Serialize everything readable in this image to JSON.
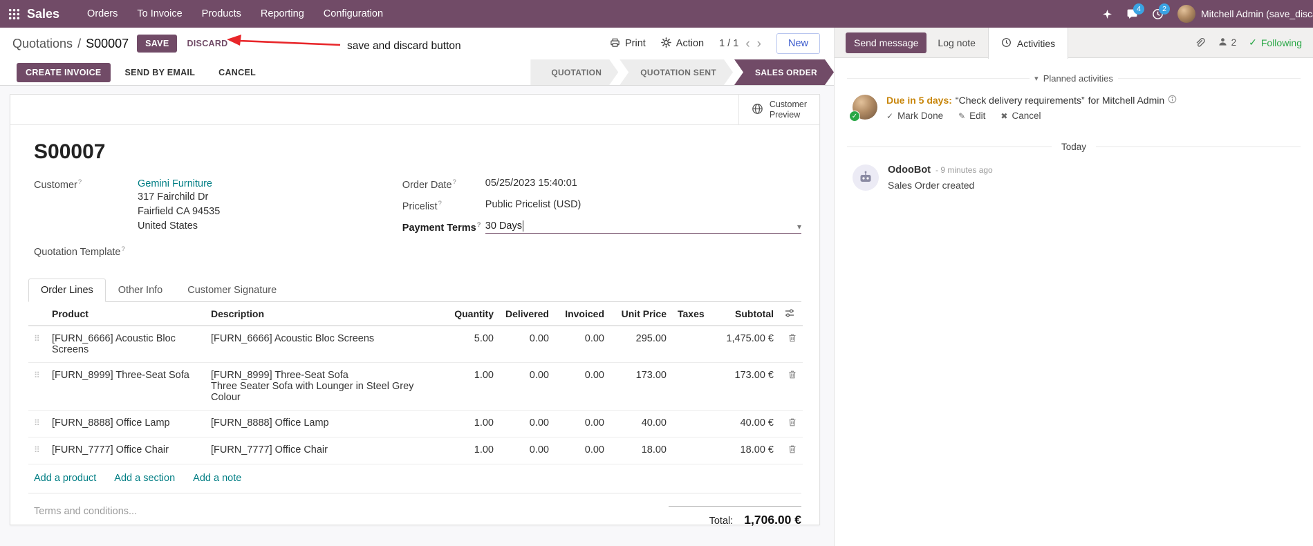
{
  "colors": {
    "navbar": "#714B67",
    "primary_button": "#714B67",
    "link": "#017E84",
    "edited_field": "#2E64D9",
    "annotation_arrow": "#E8262A",
    "following_green": "#28A745",
    "activity_due": "#C8860B"
  },
  "topbar": {
    "app_name": "Sales",
    "menus": [
      "Orders",
      "To Invoice",
      "Products",
      "Reporting",
      "Configuration"
    ],
    "message_badge": "4",
    "activity_badge": "2",
    "user_name": "Mitchell Admin (save_discar"
  },
  "breadcrumb": {
    "parent": "Quotations",
    "separator": "/",
    "current": "S00007",
    "save_label": "SAVE",
    "discard_label": "DISCARD"
  },
  "annotation": {
    "label": "save and discard button"
  },
  "control_panel": {
    "print_label": "Print",
    "action_label": "Action",
    "pager": "1 / 1",
    "new_label": "New"
  },
  "statusbar": {
    "create_invoice": "CREATE INVOICE",
    "send_by_email": "SEND BY EMAIL",
    "cancel": "CANCEL",
    "stages": [
      "QUOTATION",
      "QUOTATION SENT",
      "SALES ORDER"
    ],
    "active_stage": "SALES ORDER"
  },
  "sheet": {
    "customer_preview_line1": "Customer",
    "customer_preview_line2": "Preview",
    "title": "S00007",
    "help_marker": "?",
    "left_fields": {
      "customer_label": "Customer",
      "customer_value": "Gemini Furniture",
      "address": [
        "317 Fairchild Dr",
        "Fairfield CA 94535",
        "United States"
      ],
      "quotation_template_label": "Quotation Template"
    },
    "right_fields": {
      "order_date_label": "Order Date",
      "order_date_value": "05/25/2023 15:40:01",
      "pricelist_label": "Pricelist",
      "pricelist_value": "Public Pricelist (USD)",
      "payment_terms_label": "Payment Terms",
      "payment_terms_value": "30 Days"
    },
    "tabs": [
      "Order Lines",
      "Other Info",
      "Customer Signature"
    ],
    "table": {
      "headers": [
        "Product",
        "Description",
        "Quantity",
        "Delivered",
        "Invoiced",
        "Unit Price",
        "Taxes",
        "Subtotal"
      ],
      "rows": [
        {
          "product": "[FURN_6666] Acoustic Bloc Screens",
          "description": "[FURN_6666] Acoustic Bloc Screens",
          "description_line2": "",
          "quantity": "5.00",
          "delivered": "0.00",
          "invoiced": "0.00",
          "unit_price": "295.00",
          "taxes": "",
          "subtotal": "1,475.00 €"
        },
        {
          "product": "[FURN_8999] Three-Seat Sofa",
          "description": "[FURN_8999] Three-Seat Sofa",
          "description_line2": "Three Seater Sofa with Lounger in Steel Grey Colour",
          "quantity": "1.00",
          "delivered": "0.00",
          "invoiced": "0.00",
          "unit_price": "173.00",
          "taxes": "",
          "subtotal": "173.00 €"
        },
        {
          "product": "[FURN_8888] Office Lamp",
          "description": "[FURN_8888] Office Lamp",
          "description_line2": "",
          "quantity": "1.00",
          "delivered": "0.00",
          "invoiced": "0.00",
          "unit_price": "40.00",
          "taxes": "",
          "subtotal": "40.00 €"
        },
        {
          "product": "[FURN_7777] Office Chair",
          "description": "[FURN_7777] Office Chair",
          "description_line2": "",
          "quantity": "1.00",
          "delivered": "0.00",
          "invoiced": "0.00",
          "unit_price": "18.00",
          "taxes": "",
          "subtotal": "18.00 €"
        }
      ],
      "add_links": [
        "Add a product",
        "Add a section",
        "Add a note"
      ]
    },
    "terms_placeholder": "Terms and conditions...",
    "total_label": "Total:",
    "total_value": "1,706.00 €"
  },
  "chatter": {
    "send_message": "Send message",
    "log_note": "Log note",
    "activities_tab": "Activities",
    "follower_count": "2",
    "following": "Following",
    "planned_activities": "Planned activities",
    "activity": {
      "due": "Due in 5 days:",
      "summary": "“Check delivery requirements”",
      "assigned": "for Mitchell Admin",
      "mark_done": "Mark Done",
      "edit": "Edit",
      "cancel": "Cancel"
    },
    "date_separator": "Today",
    "message": {
      "author": "OdooBot",
      "timestamp": "- 9 minutes ago",
      "body": "Sales Order created"
    }
  },
  "glyphs": {
    "prev": "‹",
    "next": "›",
    "caret_down": "▾",
    "check": "✓",
    "pencil": "✎",
    "cross": "✖",
    "drag_handle": "⠿"
  }
}
